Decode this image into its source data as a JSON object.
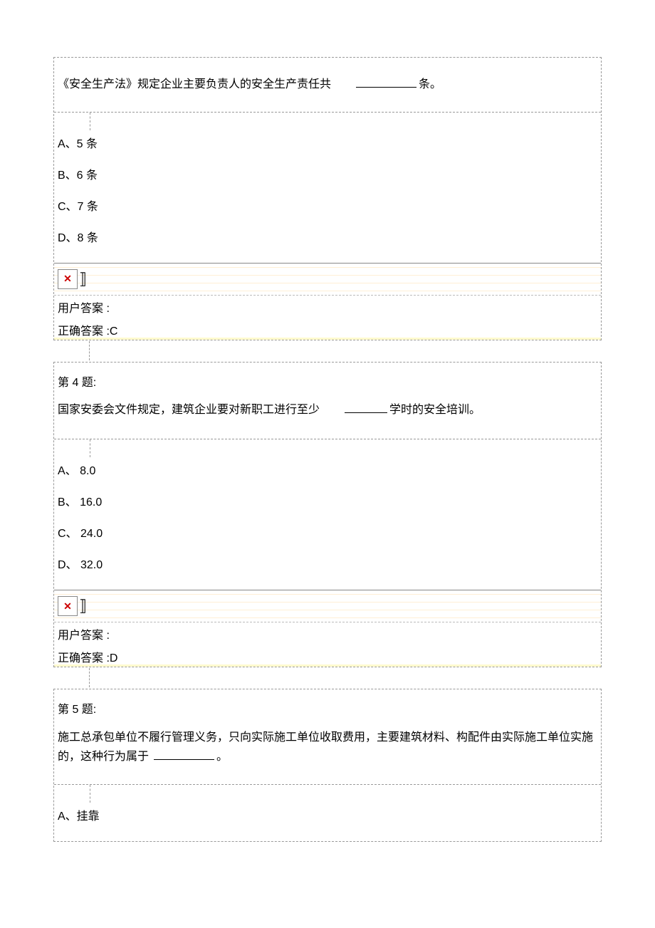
{
  "questions": [
    {
      "text_parts": [
        "《安全生产法》规定企业主要负责人的安全生产责任共　　",
        "条。"
      ],
      "options": [
        "A、5 条",
        "B、6 条",
        "C、7 条",
        "D、8 条"
      ],
      "user_answer_label": "用户答案 :",
      "correct_answer_label": "正确答案 :",
      "correct_answer": "C"
    },
    {
      "number": "第 4 题:",
      "text_parts": [
        "国家安委会文件规定，建筑企业要对新职工进行至少　　",
        "学时的安全培训。"
      ],
      "options": [
        "A、 8.0",
        "B、 16.0",
        "C、 24.0",
        "D、 32.0"
      ],
      "user_answer_label": "用户答案 :",
      "correct_answer_label": "正确答案 :",
      "correct_answer": "D"
    },
    {
      "number": "第 5 题:",
      "text_parts": [
        "施工总承包单位不履行管理义务，只向实际施工单位收取费用，主要建筑材料、构配件由实际施工单位实施的，这种行为属于 ",
        "。"
      ],
      "options": [
        "A、挂靠"
      ]
    }
  ],
  "icons": {
    "image_error": "✕"
  }
}
